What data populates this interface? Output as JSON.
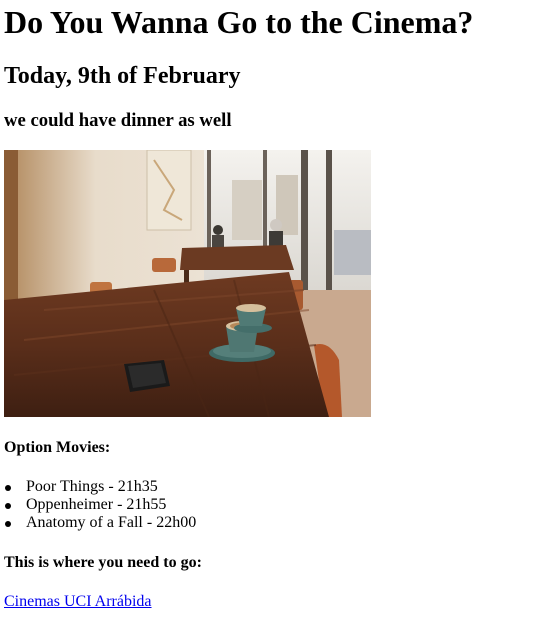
{
  "page": {
    "title": "Do You Wanna Go to the Cinema?",
    "date": "Today, 9th of February",
    "subtitle": "we could have dinner as well"
  },
  "photo": {
    "icon": "cafe-table-coffee-photo"
  },
  "movies": {
    "heading": "Option Movies:",
    "items": [
      "Poor Things - 21h35",
      "Oppenheimer - 21h55",
      "Anatomy of a Fall - 22h00"
    ]
  },
  "location": {
    "heading": "This is where you need to go:",
    "link_text": "Cinemas UCI Arrábida"
  },
  "colors": {
    "link": "#0000ee",
    "text": "#000000",
    "background": "#ffffff"
  }
}
